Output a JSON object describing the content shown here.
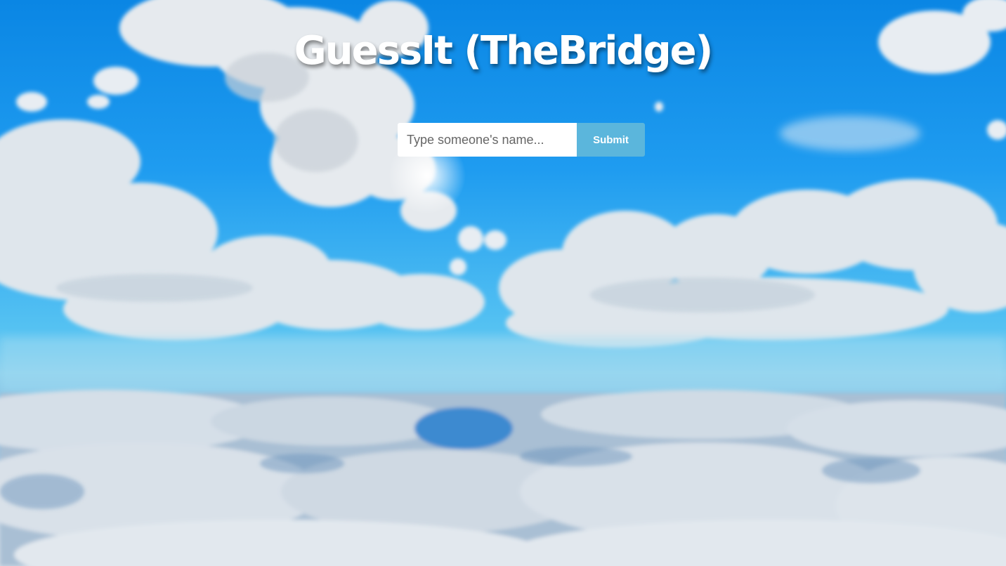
{
  "page": {
    "title": "GuessIt (TheBridge)"
  },
  "search": {
    "placeholder": "Type someone's name...",
    "value": "",
    "submit_label": "Submit"
  },
  "colors": {
    "sky": "#1f9cf0",
    "submit_button": "#5bb6dc",
    "title_text": "#ffffff"
  }
}
